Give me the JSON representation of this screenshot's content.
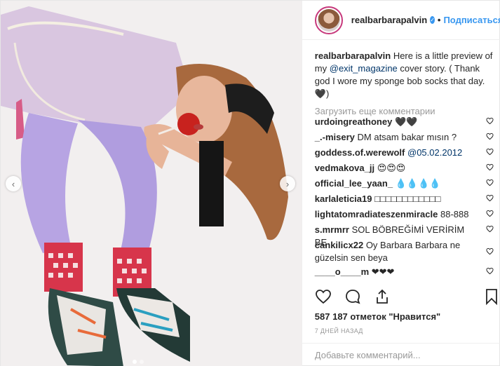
{
  "header": {
    "username": "realbarbarapalvin",
    "verified_icon": "verified-badge-icon",
    "separator": "•",
    "follow_label": "Подписаться"
  },
  "caption": {
    "username": "realbarbarapalvin",
    "text_before": "Here is a little preview of my ",
    "mention": "@exit_magazine",
    "text_after": " cover story. ( Thank god I wore my sponge bob socks that day. 🖤)"
  },
  "load_more": "Загрузить еще комментарии",
  "comments": [
    {
      "user": "urdoingreathoney",
      "text": "🖤🖤",
      "mention": ""
    },
    {
      "user": "_.-misery",
      "text": "DM atsam bakar mısın ?",
      "mention": ""
    },
    {
      "user": "goddess.of.werewolf",
      "text": "",
      "mention": "@05.02.2012"
    },
    {
      "user": "vedmakova_jj",
      "text": "😍😍😍",
      "mention": ""
    },
    {
      "user": "official_lee_yaan_",
      "text": "💧💧💧💧",
      "mention": ""
    },
    {
      "user": "karlaleticia19",
      "text": "□□□□□□□□□□□□",
      "mention": ""
    },
    {
      "user": "lightatomradiateszenmiracle",
      "text": "88-888",
      "mention": ""
    },
    {
      "user": "s.mrmrr",
      "text": "SOL BÖBREĞİMİ VERİRİM BE",
      "mention": ""
    },
    {
      "user": "cankilicx22",
      "text": "Oy Barbara Barbara ne güzelsin sen beya",
      "mention": ""
    },
    {
      "user": "____o____m",
      "text": "❤❤❤",
      "mention": ""
    }
  ],
  "actions": {
    "like_icon": "heart-icon",
    "comment_icon": "comment-icon",
    "share_icon": "share-icon",
    "save_icon": "bookmark-icon"
  },
  "likes": "587 187 отметок \"Нравится\"",
  "time": "7 дней назад",
  "add_comment": {
    "placeholder": "Добавьте комментарий...",
    "value": ""
  },
  "carousel": {
    "prev_icon": "‹",
    "next_icon": "›",
    "dot_count": 2,
    "active_dot": 1
  },
  "colors": {
    "accent": "#3897f0",
    "text": "#262626",
    "muted": "#999999",
    "link": "#003569",
    "story_ring": "#c7397c"
  }
}
